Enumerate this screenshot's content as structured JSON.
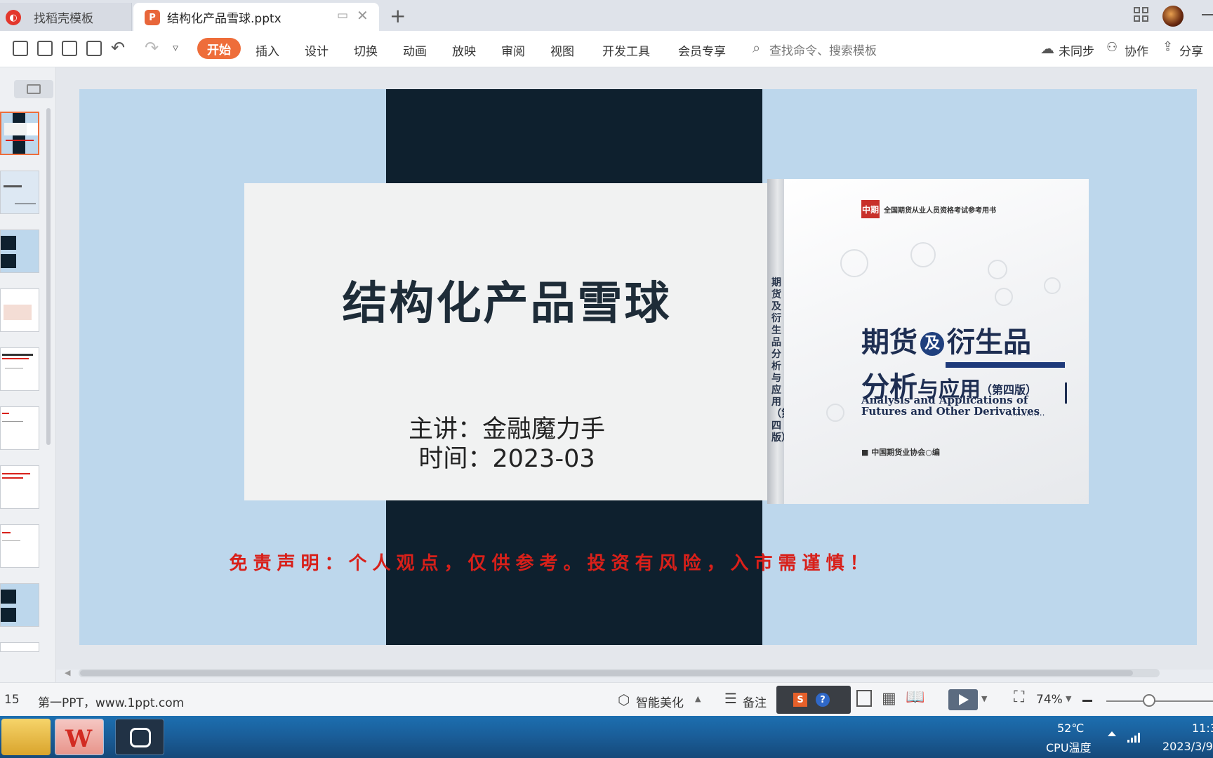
{
  "tabs": [
    {
      "label": "找稻壳模板",
      "icon": "docer-logo-icon"
    },
    {
      "label": "结构化产品雪球.pptx",
      "icon": "ppt-file-icon"
    }
  ],
  "toolbar": {
    "menus": [
      "开始",
      "插入",
      "设计",
      "切换",
      "动画",
      "放映",
      "审阅",
      "视图",
      "开发工具",
      "会员专享"
    ],
    "active_menu": "开始",
    "search_placeholder": "查找命令、搜索模板",
    "sync_label": "未同步",
    "collab_label": "协作",
    "share_label": "分享",
    "accent_color": "#ee6d3a"
  },
  "slide": {
    "title": "结构化产品雪球",
    "presenter": "主讲：金融魔力手",
    "date": "时间：2023-03",
    "disclaimer": "免责声明：个人观点，仅供参考。投资有风险，入市需谨慎！",
    "bg_color": "#bdd7ec",
    "band_color": "#0e202e"
  },
  "book": {
    "publisher_logo": "中期",
    "series": "全国期货从业人员资格考试参考用书",
    "title_line1_a": "期货",
    "title_line1_ji": "及",
    "title_line1_b": "衍生品",
    "title_line2_a": "分析",
    "title_line2_b": "与应用",
    "edition": "（第四版）",
    "english_line1": "Analysis and Applications of",
    "english_line2": "Futures and Other Derivatives",
    "dots": "..............",
    "publisher": "■ 中国期货业协会○编",
    "spine_text": "期货及衍生品分析与应用（第四版）"
  },
  "statusbar": {
    "slide_count": "15",
    "template_text": "第一PPT，www.1ppt.com",
    "beautify_label": "智能美化",
    "notes_label": "备注",
    "zoom": "74%",
    "zoom_fraction": 0.4
  },
  "ime": {
    "s_label": "S",
    "help_label": "?"
  },
  "taskbar": {
    "temp": "52℃",
    "temp_label": "CPU温度",
    "time": "11:3",
    "date": "2023/3/9"
  }
}
